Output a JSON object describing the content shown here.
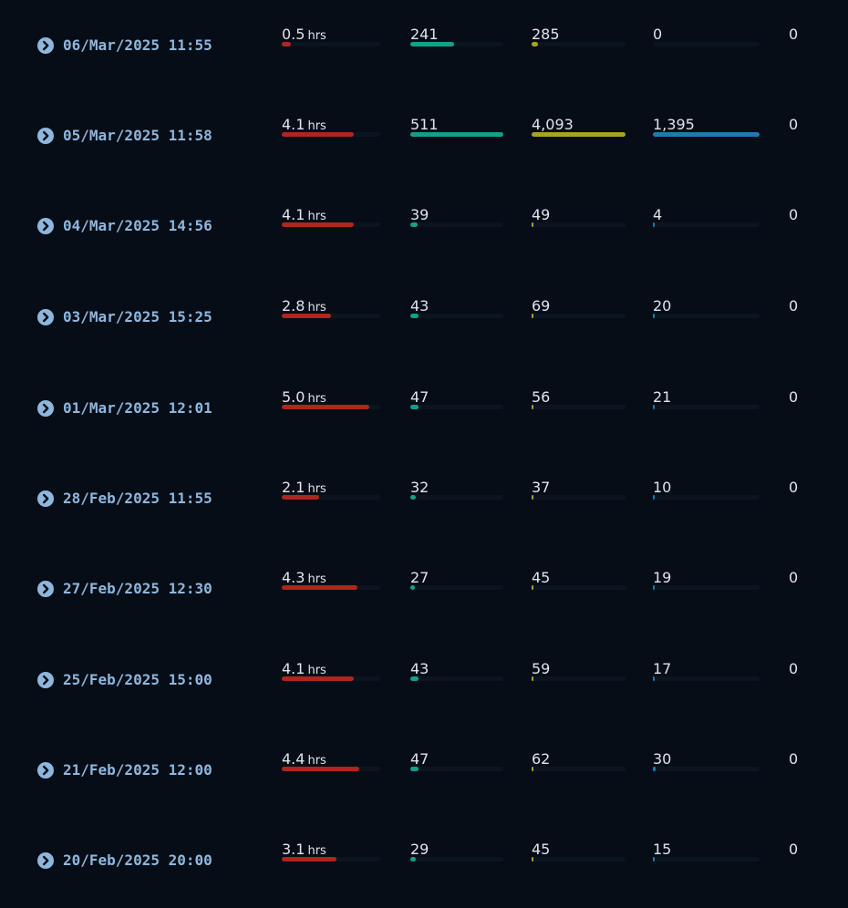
{
  "columns": {
    "hours": {
      "unit": "hrs",
      "color": "#b0251c",
      "max": 5.6
    },
    "col2": {
      "color": "#14a088",
      "max": 511
    },
    "col3": {
      "color": "#a7a324",
      "max": 4093
    },
    "col4": {
      "color": "#1f79b3",
      "max": 1395
    }
  },
  "rows": [
    {
      "date": "06/Mar/2025 11:55",
      "hours": "0.5",
      "hours_num": 0.5,
      "c2": "241",
      "c2_num": 241,
      "c3": "285",
      "c3_num": 285,
      "c4": "0",
      "c4_num": 0,
      "c5": "0"
    },
    {
      "date": "05/Mar/2025 11:58",
      "hours": "4.1",
      "hours_num": 4.1,
      "c2": "511",
      "c2_num": 511,
      "c3": "4,093",
      "c3_num": 4093,
      "c4": "1,395",
      "c4_num": 1395,
      "c5": "0"
    },
    {
      "date": "04/Mar/2025 14:56",
      "hours": "4.1",
      "hours_num": 4.1,
      "c2": "39",
      "c2_num": 39,
      "c3": "49",
      "c3_num": 49,
      "c4": "4",
      "c4_num": 4,
      "c5": "0"
    },
    {
      "date": "03/Mar/2025 15:25",
      "hours": "2.8",
      "hours_num": 2.8,
      "c2": "43",
      "c2_num": 43,
      "c3": "69",
      "c3_num": 69,
      "c4": "20",
      "c4_num": 20,
      "c5": "0"
    },
    {
      "date": "01/Mar/2025 12:01",
      "hours": "5.0",
      "hours_num": 5.0,
      "c2": "47",
      "c2_num": 47,
      "c3": "56",
      "c3_num": 56,
      "c4": "21",
      "c4_num": 21,
      "c5": "0"
    },
    {
      "date": "28/Feb/2025 11:55",
      "hours": "2.1",
      "hours_num": 2.1,
      "c2": "32",
      "c2_num": 32,
      "c3": "37",
      "c3_num": 37,
      "c4": "10",
      "c4_num": 10,
      "c5": "0"
    },
    {
      "date": "27/Feb/2025 12:30",
      "hours": "4.3",
      "hours_num": 4.3,
      "c2": "27",
      "c2_num": 27,
      "c3": "45",
      "c3_num": 45,
      "c4": "19",
      "c4_num": 19,
      "c5": "0"
    },
    {
      "date": "25/Feb/2025 15:00",
      "hours": "4.1",
      "hours_num": 4.1,
      "c2": "43",
      "c2_num": 43,
      "c3": "59",
      "c3_num": 59,
      "c4": "17",
      "c4_num": 17,
      "c5": "0"
    },
    {
      "date": "21/Feb/2025 12:00",
      "hours": "4.4",
      "hours_num": 4.4,
      "c2": "47",
      "c2_num": 47,
      "c3": "62",
      "c3_num": 62,
      "c4": "30",
      "c4_num": 30,
      "c5": "0"
    },
    {
      "date": "20/Feb/2025 20:00",
      "hours": "3.1",
      "hours_num": 3.1,
      "c2": "29",
      "c2_num": 29,
      "c3": "45",
      "c3_num": 45,
      "c4": "15",
      "c4_num": 15,
      "c5": "0"
    }
  ]
}
